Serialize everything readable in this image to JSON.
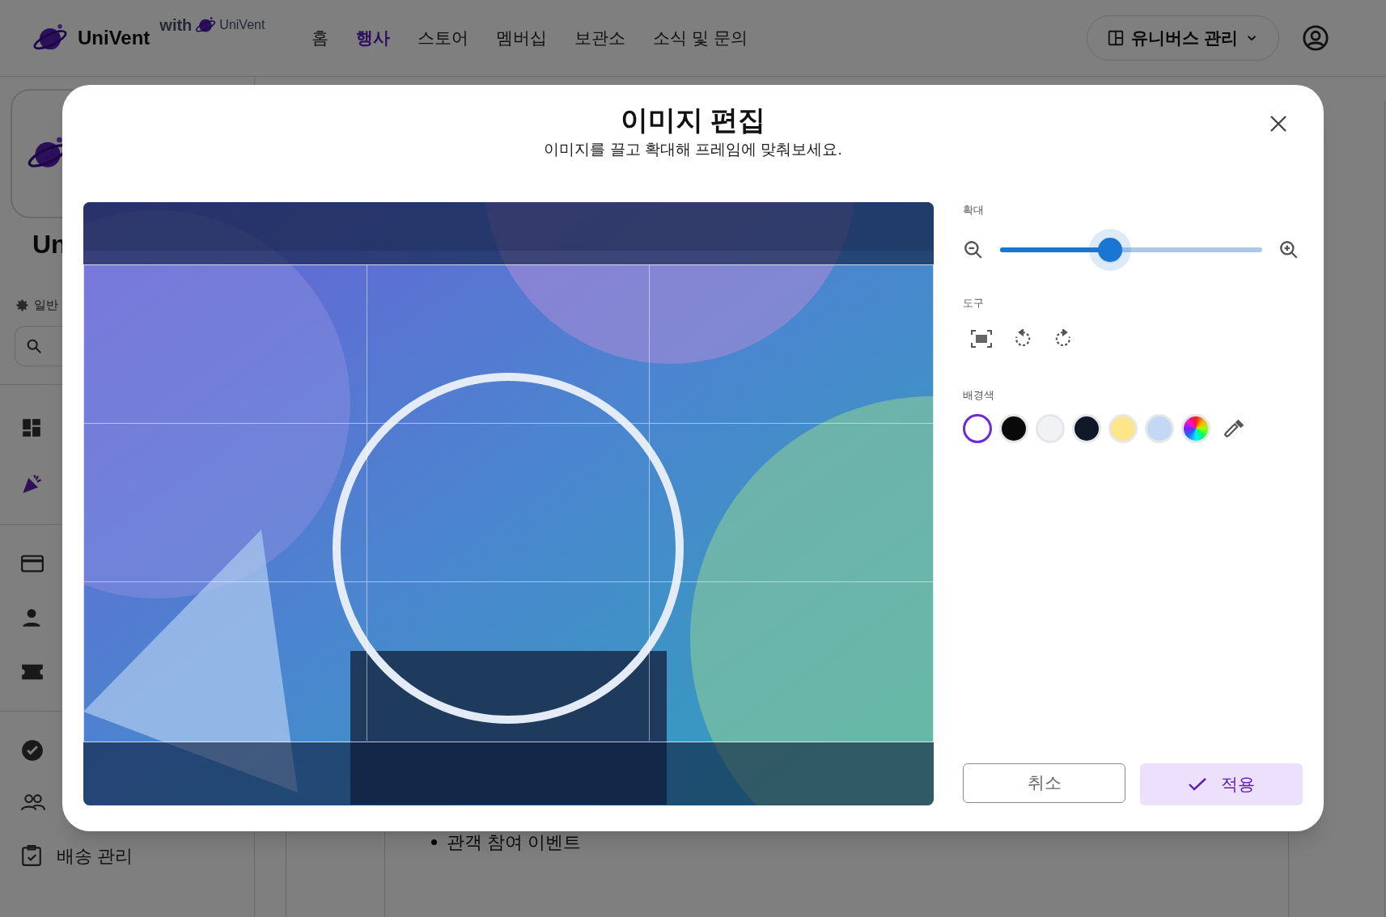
{
  "header": {
    "logo": "UniVent",
    "with": "with",
    "partner_logo": "UniVent",
    "nav": [
      {
        "label": "홈",
        "selected": false
      },
      {
        "label": "행사",
        "selected": true
      },
      {
        "label": "스토어",
        "selected": false
      },
      {
        "label": "멤버십",
        "selected": false
      },
      {
        "label": "보관소",
        "selected": false
      },
      {
        "label": "소식 및 문의",
        "selected": false
      }
    ],
    "manage_button": "유니버스 관리"
  },
  "sidebar": {
    "title": "Un",
    "section": "일반",
    "last_item": "배송 관리"
  },
  "content": {
    "bullet": "관객 참여 이벤트"
  },
  "dialog": {
    "title": "이미지 편집",
    "subtitle": "이미지를 끌고 확대해 프레임에 맞춰보세요.",
    "zoom": {
      "label": "확대",
      "level": 0.42
    },
    "tools": {
      "label": "도구"
    },
    "background": {
      "label": "배경색",
      "swatches": [
        {
          "kind": "solid",
          "color": "#ffffff",
          "selected": true
        },
        {
          "kind": "solid",
          "color": "#0a0a0a",
          "selected": false
        },
        {
          "kind": "solid",
          "color": "#f1f2f4",
          "selected": false
        },
        {
          "kind": "solid",
          "color": "#111827",
          "selected": false
        },
        {
          "kind": "solid",
          "color": "#fde68a",
          "selected": false
        },
        {
          "kind": "solid",
          "color": "#c3d8f5",
          "selected": false
        },
        {
          "kind": "picker",
          "selected": false
        }
      ]
    },
    "cancel": "취소",
    "apply": "적용"
  }
}
